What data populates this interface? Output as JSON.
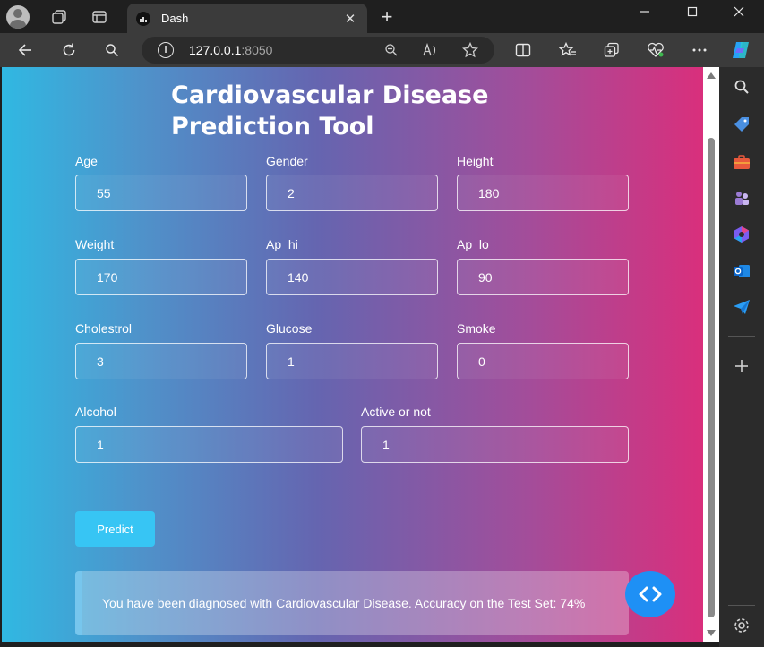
{
  "browser": {
    "tab_title": "Dash",
    "tab_close": "✕",
    "new_tab": "+",
    "url_host": "127.0.0.1",
    "url_port": ":8050"
  },
  "page": {
    "title_line1": "Cardiovascular Disease",
    "title_line2": "Prediction Tool"
  },
  "fields": [
    {
      "label": "Age",
      "value": "55"
    },
    {
      "label": "Gender",
      "value": "2"
    },
    {
      "label": "Height",
      "value": "180"
    },
    {
      "label": "Weight",
      "value": "170"
    },
    {
      "label": "Ap_hi",
      "value": "140"
    },
    {
      "label": "Ap_lo",
      "value": "90"
    },
    {
      "label": "Cholestrol",
      "value": "3"
    },
    {
      "label": "Glucose",
      "value": "1"
    },
    {
      "label": "Smoke",
      "value": "0"
    },
    {
      "label": "Alcohol",
      "value": "1"
    },
    {
      "label": "Active or not",
      "value": "1"
    }
  ],
  "predict_label": "Predict",
  "result_text": "You have been diagnosed with Cardiovascular Disease. Accuracy on the Test Set: 74%",
  "colors": {
    "gradient_start": "#30b8e2",
    "gradient_end": "#d92f7c",
    "button": "#37c5f4",
    "debug_button": "#1e90f5"
  }
}
